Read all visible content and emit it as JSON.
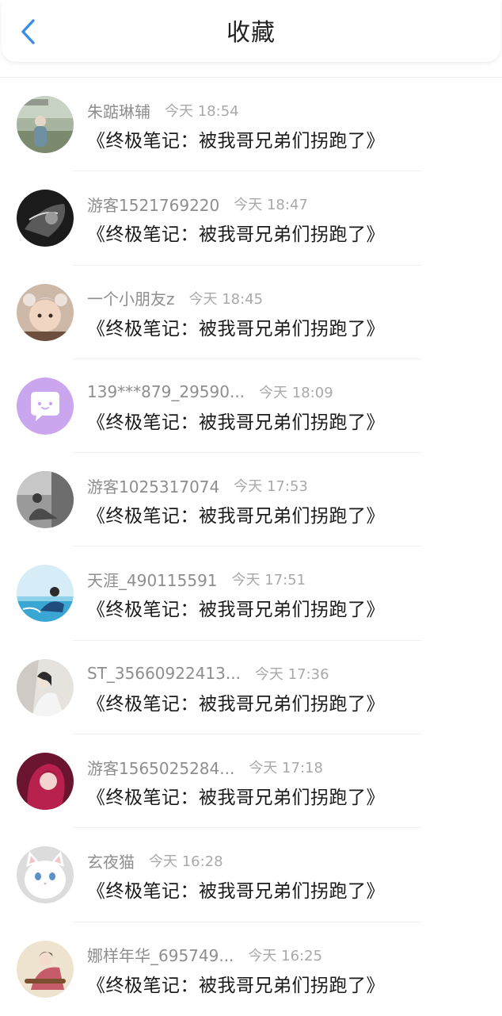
{
  "header": {
    "title": "收藏",
    "back_icon": "chevron-left-icon",
    "accent_color": "#3a8ee6"
  },
  "items": [
    {
      "username": "朱踮琳辅",
      "time": "今天 18:54",
      "content": "《终极笔记：被我哥兄弟们拐跑了》",
      "avatar": "photo-avatar"
    },
    {
      "username": "游客1521769220",
      "time": "今天 18:47",
      "content": "《终极笔记：被我哥兄弟们拐跑了》",
      "avatar": "photo-avatar"
    },
    {
      "username": "一个小朋友z",
      "time": "今天 18:45",
      "content": "《终极笔记：被我哥兄弟们拐跑了》",
      "avatar": "photo-avatar"
    },
    {
      "username": "139***879_29590...",
      "time": "今天 18:09",
      "content": "《终极笔记：被我哥兄弟们拐跑了》",
      "avatar": "default-chat-avatar"
    },
    {
      "username": "游客1025317074",
      "time": "今天 17:53",
      "content": "《终极笔记：被我哥兄弟们拐跑了》",
      "avatar": "photo-avatar"
    },
    {
      "username": "天涯_490115591",
      "time": "今天 17:51",
      "content": "《终极笔记：被我哥兄弟们拐跑了》",
      "avatar": "photo-avatar"
    },
    {
      "username": "ST_35660922413...",
      "time": "今天 17:36",
      "content": "《终极笔记：被我哥兄弟们拐跑了》",
      "avatar": "photo-avatar"
    },
    {
      "username": "游客1565025284...",
      "time": "今天 17:18",
      "content": "《终极笔记：被我哥兄弟们拐跑了》",
      "avatar": "photo-avatar"
    },
    {
      "username": "玄夜猫",
      "time": "今天 16:28",
      "content": "《终极笔记：被我哥兄弟们拐跑了》",
      "avatar": "photo-avatar"
    },
    {
      "username": "娜样年华_695749...",
      "time": "今天 16:25",
      "content": "《终极笔记：被我哥兄弟们拐跑了》",
      "avatar": "photo-avatar"
    }
  ]
}
